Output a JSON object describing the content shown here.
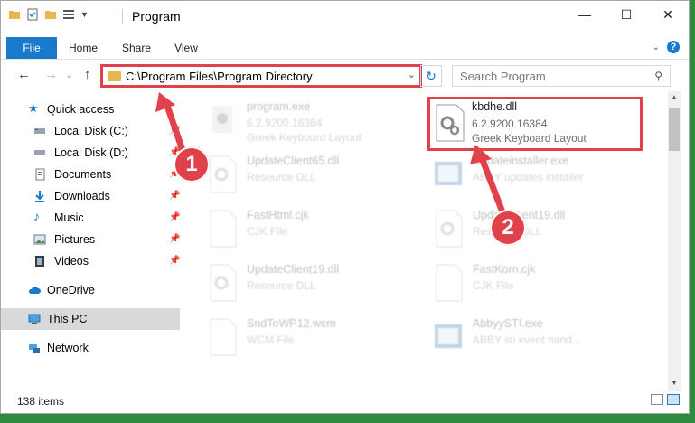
{
  "window": {
    "title": "Program"
  },
  "ribbon": {
    "tabs": [
      "File",
      "Home",
      "Share",
      "View"
    ]
  },
  "address": {
    "path": "C:\\Program Files\\Program Directory"
  },
  "search": {
    "placeholder": "Search Program"
  },
  "sidebar": {
    "items": [
      {
        "label": "Quick access",
        "icon": "star-icon",
        "pinned": false
      },
      {
        "label": "Local Disk (C:)",
        "icon": "drive-icon",
        "pinned": true
      },
      {
        "label": "Local Disk (D:)",
        "icon": "drive-icon",
        "pinned": true
      },
      {
        "label": "Documents",
        "icon": "documents-icon",
        "pinned": true
      },
      {
        "label": "Downloads",
        "icon": "download-icon",
        "pinned": true
      },
      {
        "label": "Music",
        "icon": "music-icon",
        "pinned": true
      },
      {
        "label": "Pictures",
        "icon": "pictures-icon",
        "pinned": true
      },
      {
        "label": "Videos",
        "icon": "videos-icon",
        "pinned": true
      },
      {
        "label": "OneDrive",
        "icon": "cloud-icon",
        "pinned": false
      },
      {
        "label": "This PC",
        "icon": "computer-icon",
        "pinned": false
      },
      {
        "label": "Network",
        "icon": "network-icon",
        "pinned": false
      }
    ]
  },
  "files": [
    {
      "name": "program.exe",
      "meta1": "6.2.9200.16384",
      "meta2": "Greek Keyboard Layout"
    },
    {
      "name": "kbdhe.dll",
      "meta1": "6.2.9200.16384",
      "meta2": "Greek Keyboard Layout"
    },
    {
      "name": "UpdateClient65.dll",
      "meta1": "Resource DLL",
      "meta2": ""
    },
    {
      "name": "Updateinstaller.exe",
      "meta1": "ABBY updates installer",
      "meta2": ""
    },
    {
      "name": "FastHtml.cjk",
      "meta1": "CJK File",
      "meta2": ""
    },
    {
      "name": "UpdateClient19.dll",
      "meta1": "Resource DLL",
      "meta2": ""
    },
    {
      "name": "UpdateClient19.dll",
      "meta1": "Resource DLL",
      "meta2": ""
    },
    {
      "name": "FastKorn.cjk",
      "meta1": "CJK File",
      "meta2": ""
    },
    {
      "name": "SndToWP12.wcm",
      "meta1": "WCM File",
      "meta2": ""
    },
    {
      "name": "AbbyySTI.exe",
      "meta1": "ABBY sti event hand...",
      "meta2": ""
    }
  ],
  "status": {
    "count": "138 items"
  },
  "callouts": [
    "1",
    "2"
  ],
  "colors": {
    "accent": "#1979ca",
    "highlight": "#e0424b",
    "folder": "#e8b64b"
  }
}
